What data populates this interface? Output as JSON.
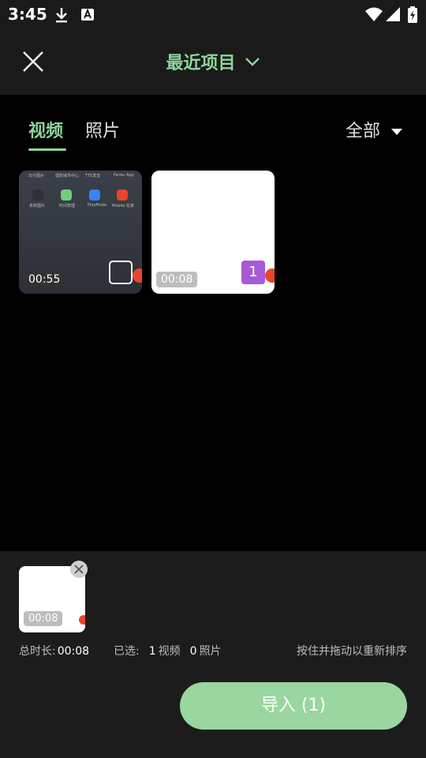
{
  "status_bar": {
    "time": "3:45",
    "icons": [
      "download-icon",
      "font-a-icon",
      "wifi-icon",
      "signal-icon",
      "battery-charging-icon"
    ]
  },
  "header": {
    "title": "最近项目",
    "close_icon": "close-icon",
    "dropdown_icon": "chevron-down-icon"
  },
  "tabs": [
    {
      "label": "视频",
      "active": true
    },
    {
      "label": "照片",
      "active": false
    }
  ],
  "filter": {
    "label": "全部"
  },
  "media": [
    {
      "duration": "00:55",
      "selected": false,
      "thumb_labels": [
        "日光图片",
        "理想城市中心",
        "TTS发音",
        "Faceu App",
        "系统图片",
        "时间管理",
        "PlayMode",
        "Mobile 玩家"
      ]
    },
    {
      "duration": "00:08",
      "selected": true,
      "selection_index": "1"
    }
  ],
  "selection": {
    "thumb_duration": "00:08",
    "total_label": "总时长:",
    "total_value": "00:08",
    "selected_label": "已选:",
    "video_count": "1",
    "video_unit": "视频",
    "photo_count": "0",
    "photo_unit": "照片",
    "hint": "按住并拖动以重新排序"
  },
  "import_button": {
    "label": "导入 (1)"
  },
  "colors": {
    "accent": "#8fd49a",
    "button": "#9ad69f",
    "selection_badge": "#a65ad8",
    "app_badge": "#e8452c"
  }
}
